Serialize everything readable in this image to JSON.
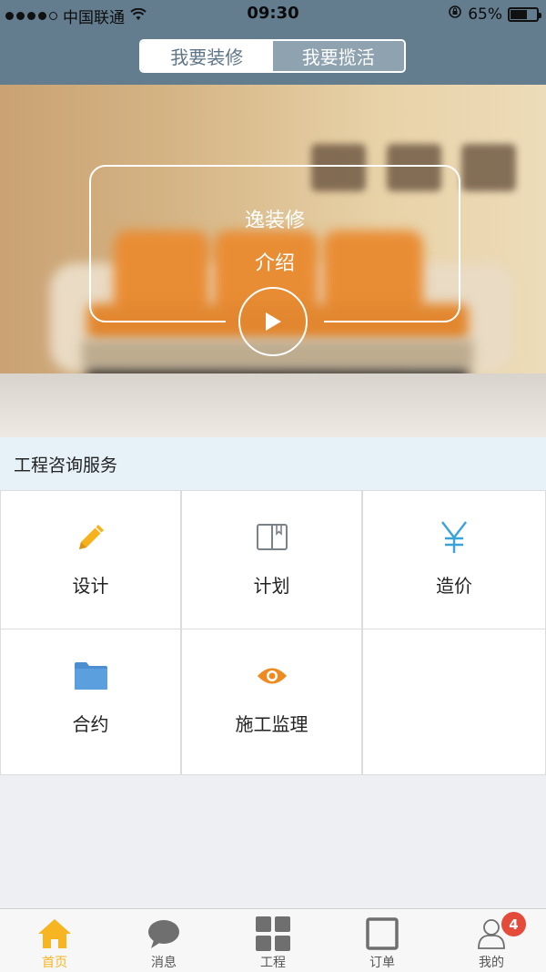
{
  "status_bar": {
    "carrier": "中国联通",
    "time": "09:30",
    "battery_percent": "65%",
    "battery_level": 0.65
  },
  "segmented": {
    "options": [
      "我要装修",
      "我要揽活"
    ],
    "selected": "我要装修"
  },
  "hero": {
    "title": "逸装修",
    "subtitle": "介绍"
  },
  "section": {
    "title": "工程咨询服务",
    "items": [
      {
        "label": "设计",
        "icon": "pencil-icon",
        "color": "#f5b21b"
      },
      {
        "label": "计划",
        "icon": "book-icon",
        "color": "#7a8289"
      },
      {
        "label": "造价",
        "icon": "yen-icon",
        "color": "#39a3d9"
      },
      {
        "label": "合约",
        "icon": "folder-icon",
        "color": "#4b8fd1"
      },
      {
        "label": "施工监理",
        "icon": "eye-icon",
        "color": "#ef8a1f"
      }
    ]
  },
  "tabbar": {
    "items": [
      {
        "label": "首页",
        "icon": "home-icon"
      },
      {
        "label": "消息",
        "icon": "message-icon"
      },
      {
        "label": "工程",
        "icon": "grid-icon"
      },
      {
        "label": "订单",
        "icon": "order-icon"
      },
      {
        "label": "我的",
        "icon": "user-icon"
      }
    ],
    "active": "首页",
    "badge": "4"
  },
  "colors": {
    "header_bg": "#637d8f",
    "accent": "#f6b521",
    "badge": "#e44b3b"
  }
}
